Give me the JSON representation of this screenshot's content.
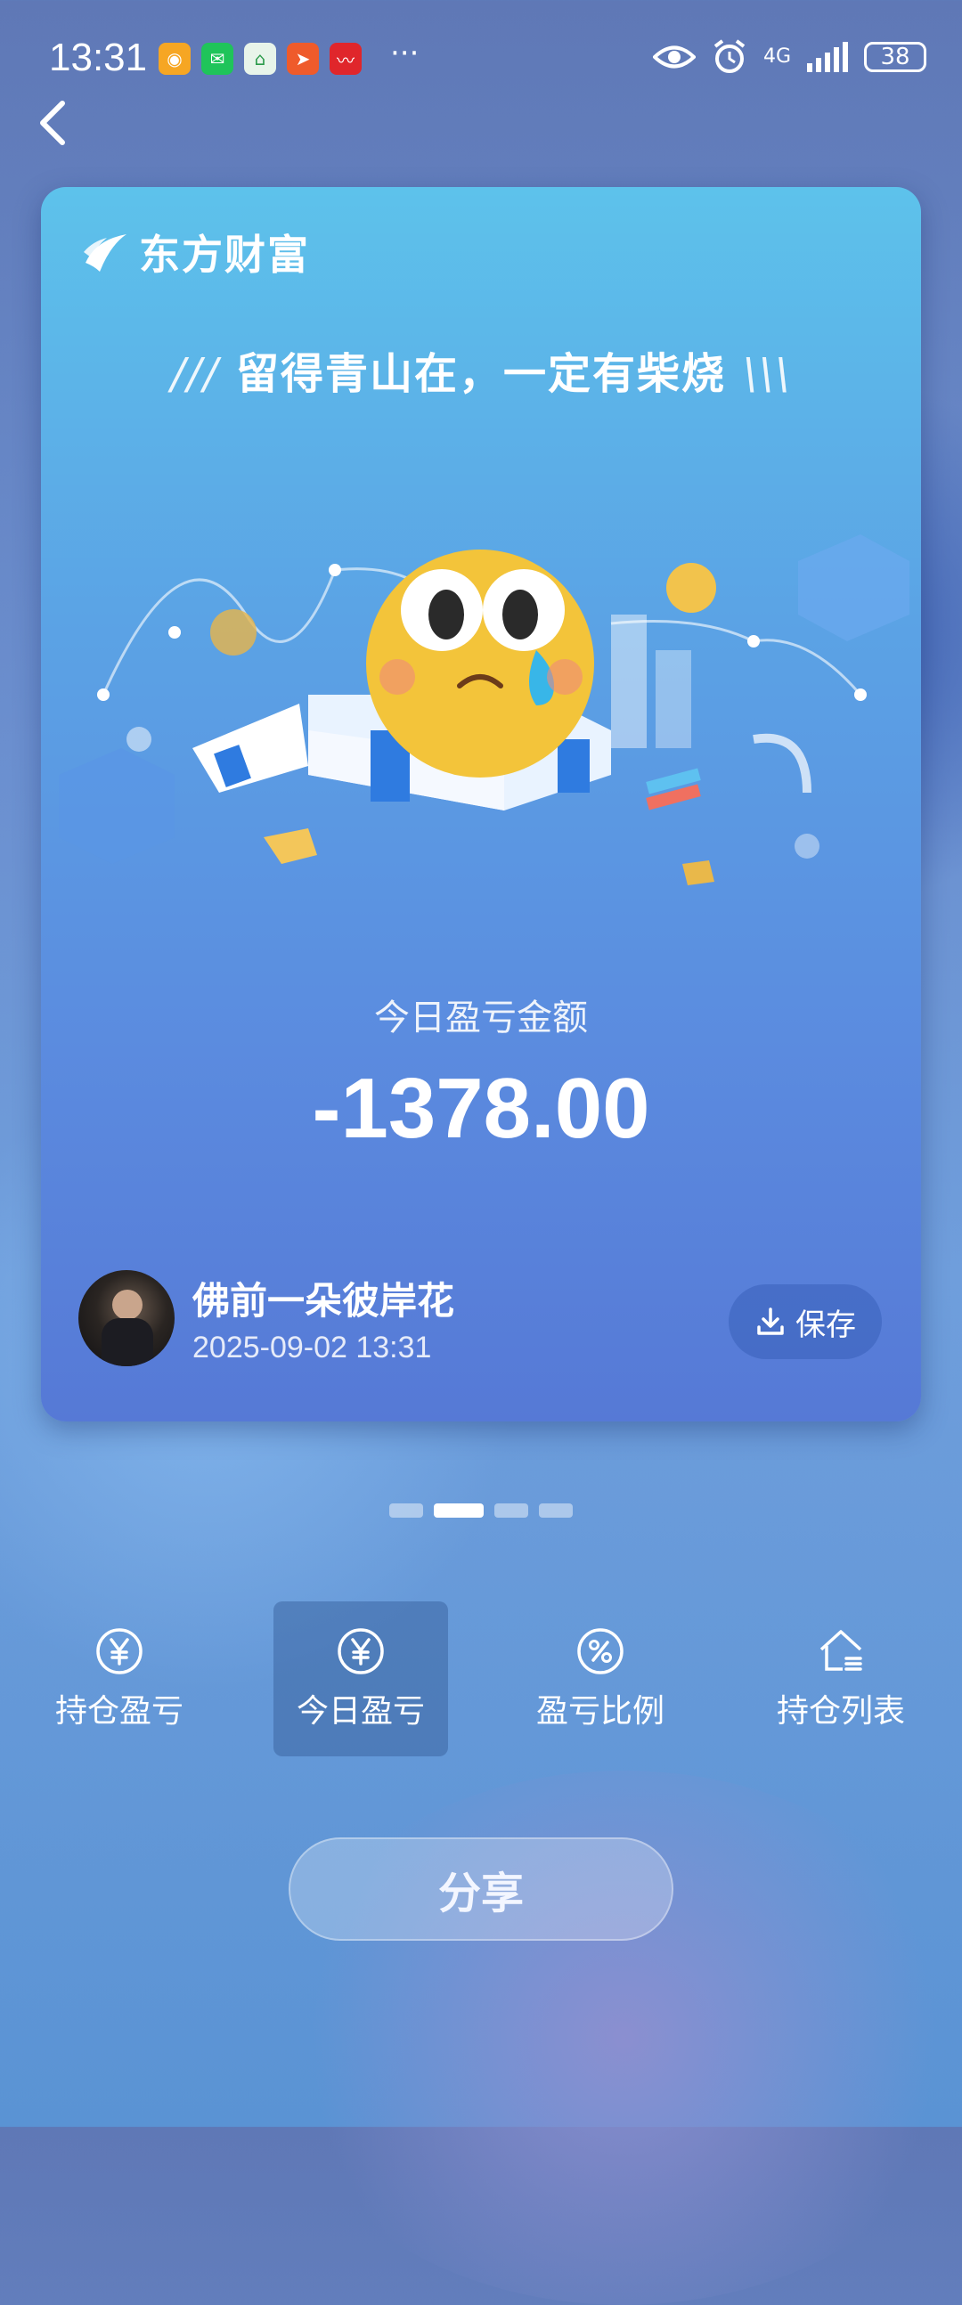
{
  "status_bar": {
    "time": "13:31",
    "network": "4G",
    "battery": "38"
  },
  "card": {
    "brand": "东方财富",
    "slogan": "留得青山在，一定有柴烧",
    "slogan_left_deco": "///",
    "slogan_right_deco": "\\\\\\",
    "label": "今日盈亏金额",
    "amount": "-1378.00",
    "user_name": "佛前一朵彼岸花",
    "timestamp": "2025-09-02 13:31",
    "save_label": "保存"
  },
  "pager": {
    "count": 4,
    "active_index": 1
  },
  "tabs": [
    {
      "label": "持仓盈亏",
      "icon": "yen-circle-icon",
      "active": false
    },
    {
      "label": "今日盈亏",
      "icon": "yen-circle-icon",
      "active": true
    },
    {
      "label": "盈亏比例",
      "icon": "percent-circle-icon",
      "active": false
    },
    {
      "label": "持仓列表",
      "icon": "house-list-icon",
      "active": false
    }
  ],
  "share_label": "分享"
}
